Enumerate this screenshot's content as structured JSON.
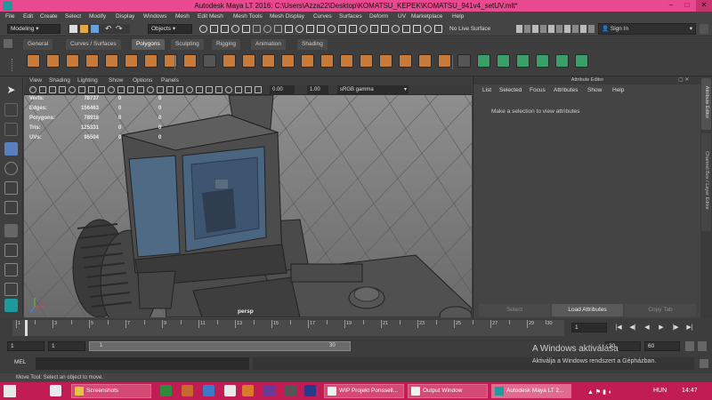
{
  "window": {
    "title": "Autodesk Maya LT 2016: C:\\Users\\Azza22\\Desktop\\KOMATSU_KEPEK\\KOMATSU_941v4_setUV.mlt*"
  },
  "menubar": [
    "File",
    "Edit",
    "Create",
    "Select",
    "Modify",
    "Display",
    "Windows",
    "Mesh",
    "Edit Mesh",
    "Mesh Tools",
    "Mesh Display",
    "Curves",
    "Surfaces",
    "Deform",
    "UV",
    "Marketplace",
    "Help"
  ],
  "statusline": {
    "mode": "Modeling",
    "objects_label": "Objects",
    "live_surface": "No Live Surface",
    "signin": "Sign In"
  },
  "shelf_tabs": [
    "General",
    "Curves / Surfaces",
    "Polygons",
    "Sculpting",
    "Rigging",
    "Animation",
    "Shading"
  ],
  "shelf_active": "Polygons",
  "viewport": {
    "menu": [
      "View",
      "Shading",
      "Lighting",
      "Show",
      "Options",
      "Panels"
    ],
    "num1": "0.00",
    "num2": "1.00",
    "colorspace": "sRGB gamma",
    "camera_label": "persp",
    "hud": [
      {
        "label": "Verts:",
        "v1": "78737",
        "v2": "0",
        "v3": "0"
      },
      {
        "label": "Edges:",
        "v1": "156463",
        "v2": "0",
        "v3": "0"
      },
      {
        "label": "Polygons:",
        "v1": "78918",
        "v2": "0",
        "v3": "0"
      },
      {
        "label": "Tris:",
        "v1": "125331",
        "v2": "0",
        "v3": "0"
      },
      {
        "label": "UVs:",
        "v1": "95504",
        "v2": "0",
        "v3": "0"
      }
    ]
  },
  "attribute_editor": {
    "title": "Attribute Editor",
    "menu": [
      "List",
      "Selected",
      "Focus",
      "Attributes",
      "Show",
      "Help"
    ],
    "message": "Make a selection to view attributes",
    "buttons": [
      "Select",
      "Load Attributes",
      "Copy Tab"
    ]
  },
  "side_tabs": [
    "Attribute Editor",
    "Channel Box / Layer Editor"
  ],
  "timeline": {
    "ticks": [
      "1",
      "2",
      "3",
      "4",
      "5",
      "6",
      "7",
      "8",
      "9",
      "10",
      "11",
      "12",
      "13",
      "14",
      "15",
      "16",
      "17",
      "18",
      "19",
      "20",
      "21",
      "22",
      "23",
      "24",
      "25",
      "26",
      "27",
      "28",
      "29",
      "30"
    ],
    "current_frame": "1"
  },
  "range": {
    "start": "1",
    "start2": "1",
    "slider_start": "1",
    "slider_end": "30",
    "end": "30",
    "end2": "60"
  },
  "mel": {
    "label": "MEL"
  },
  "helpline": "Move Tool: Select an object to move.",
  "watermark": {
    "title": "A Windows aktiválása",
    "subtitle": "Aktiválja a Windows rendszert a Gépházban."
  },
  "taskbar": {
    "items": [
      "Screenshots",
      "WIP Projekt Ponssell...",
      "Output Window",
      "Autodesk Maya LT 2..."
    ],
    "lang": "HUN",
    "clock": "14:47"
  }
}
